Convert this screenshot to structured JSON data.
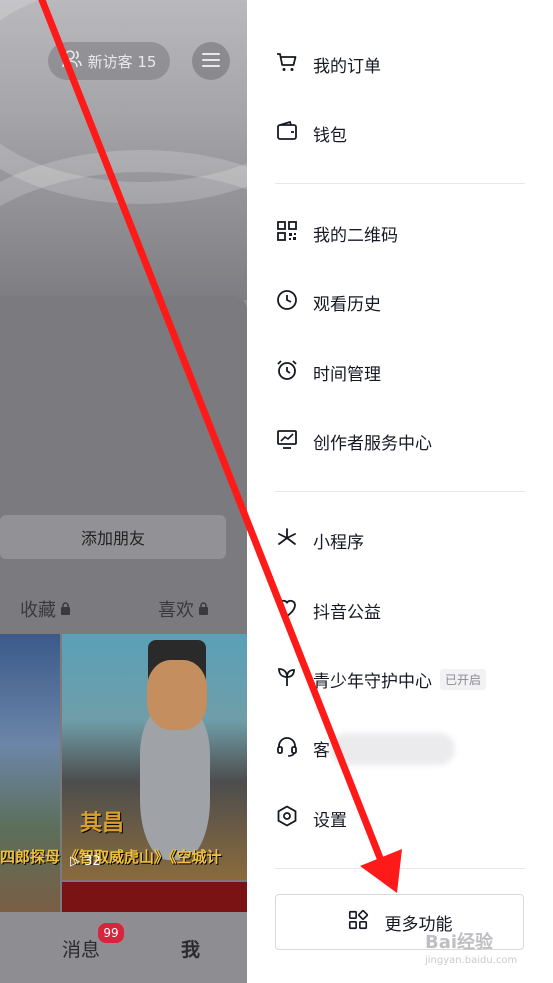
{
  "profile": {
    "visitor_label": "新访客 15",
    "add_friend": "添加朋友",
    "tabs": [
      {
        "label": "收藏",
        "locked": true
      },
      {
        "label": "喜欢",
        "locked": true
      }
    ],
    "video": {
      "caption_left": "四郎探母",
      "caption_main": "《智取威虎山》《空城计",
      "title_partial": "其昌",
      "play_count": "32"
    }
  },
  "bottom_nav": {
    "messages_label": "消息",
    "messages_badge": "99",
    "me_label": "我"
  },
  "drawer": {
    "items": [
      {
        "label": "我的订单",
        "icon": "cart-icon"
      },
      {
        "label": "钱包",
        "icon": "wallet-icon"
      },
      {
        "label": "我的二维码",
        "icon": "qrcode-icon"
      },
      {
        "label": "观看历史",
        "icon": "clock-icon"
      },
      {
        "label": "时间管理",
        "icon": "alarm-icon"
      },
      {
        "label": "创作者服务中心",
        "icon": "chart-monitor-icon"
      },
      {
        "label": "小程序",
        "icon": "asterisk-icon"
      },
      {
        "label": "抖音公益",
        "icon": "heart-icon"
      },
      {
        "label": "青少年守护中心",
        "icon": "sprout-icon",
        "tag": "已开启"
      },
      {
        "label": "客",
        "icon": "headset-icon"
      },
      {
        "label": "设置",
        "icon": "settings-hexagon-icon"
      }
    ],
    "more_button": "更多功能"
  },
  "watermark": {
    "text": "Bai经验",
    "sub": "jingyan.baidu.com"
  },
  "colors": {
    "annotation_arrow": "#ff1a1a",
    "badge": "#d8243c"
  }
}
